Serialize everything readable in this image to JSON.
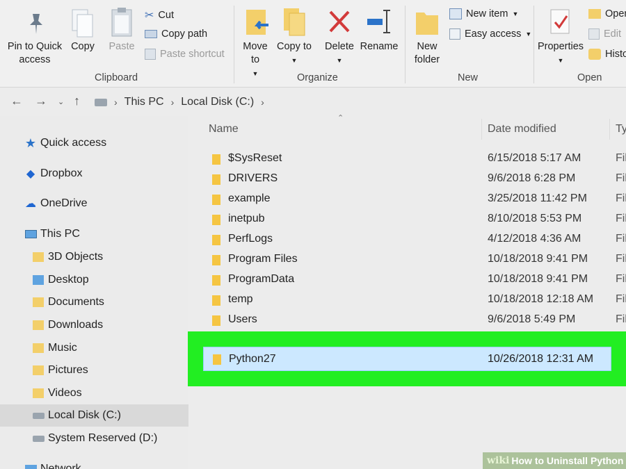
{
  "ribbon": {
    "clipboard": {
      "pin_label": "Pin to Quick access",
      "copy_label": "Copy",
      "paste_label": "Paste",
      "cut_label": "Cut",
      "copy_path_label": "Copy path",
      "paste_shortcut_label": "Paste shortcut",
      "group_label": "Clipboard"
    },
    "organize": {
      "move_to_label": "Move to",
      "copy_to_label": "Copy to",
      "delete_label": "Delete",
      "rename_label": "Rename",
      "group_label": "Organize"
    },
    "new": {
      "new_folder_label": "New folder",
      "new_item_label": "New item",
      "easy_access_label": "Easy access",
      "group_label": "New"
    },
    "open": {
      "properties_label": "Properties",
      "open_label": "Open",
      "edit_label": "Edit",
      "history_label": "History",
      "group_label": "Open"
    }
  },
  "address": {
    "crumbs": [
      "This PC",
      "Local Disk (C:)"
    ]
  },
  "sidebar": {
    "items": [
      {
        "label": "Quick access",
        "icon": "star-icon"
      },
      {
        "label": "Dropbox",
        "icon": "dropbox-icon"
      },
      {
        "label": "OneDrive",
        "icon": "cloud-icon"
      },
      {
        "label": "This PC",
        "icon": "computer-icon"
      },
      {
        "label": "3D Objects",
        "icon": "folder-icon"
      },
      {
        "label": "Desktop",
        "icon": "folder-icon"
      },
      {
        "label": "Documents",
        "icon": "folder-icon"
      },
      {
        "label": "Downloads",
        "icon": "folder-icon"
      },
      {
        "label": "Music",
        "icon": "folder-icon"
      },
      {
        "label": "Pictures",
        "icon": "folder-icon"
      },
      {
        "label": "Videos",
        "icon": "folder-icon"
      },
      {
        "label": "Local Disk (C:)",
        "icon": "drive-icon"
      },
      {
        "label": "System Reserved (D:)",
        "icon": "drive-icon"
      },
      {
        "label": "Network",
        "icon": "network-icon"
      }
    ]
  },
  "filelist": {
    "columns": {
      "name": "Name",
      "date": "Date modified",
      "type": "Ty"
    },
    "rows": [
      {
        "name": "$SysReset",
        "date": "6/15/2018 5:17 AM",
        "type": "Fil"
      },
      {
        "name": "DRIVERS",
        "date": "9/6/2018 6:28 PM",
        "type": "Fil"
      },
      {
        "name": "example",
        "date": "3/25/2018 11:42 PM",
        "type": "Fil"
      },
      {
        "name": "inetpub",
        "date": "8/10/2018 5:53 PM",
        "type": "Fil"
      },
      {
        "name": "PerfLogs",
        "date": "4/12/2018 4:36 AM",
        "type": "Fil"
      },
      {
        "name": "Program Files",
        "date": "10/18/2018 9:41 PM",
        "type": "Fil"
      },
      {
        "name": "ProgramData",
        "date": "10/18/2018 9:41 PM",
        "type": "Fil"
      },
      {
        "name": "temp",
        "date": "10/18/2018 12:18 AM",
        "type": "Fil"
      },
      {
        "name": "Users",
        "date": "9/6/2018 5:49 PM",
        "type": "Fil"
      }
    ],
    "selected": {
      "name": "Python27",
      "date": "10/26/2018 12:31 AM"
    }
  },
  "watermark": {
    "wiki": "wiki",
    "title": "How to Uninstall Python"
  },
  "colors": {
    "highlight": "#22ee22",
    "selection": "#cce8ff",
    "folder": "#f5c542"
  }
}
